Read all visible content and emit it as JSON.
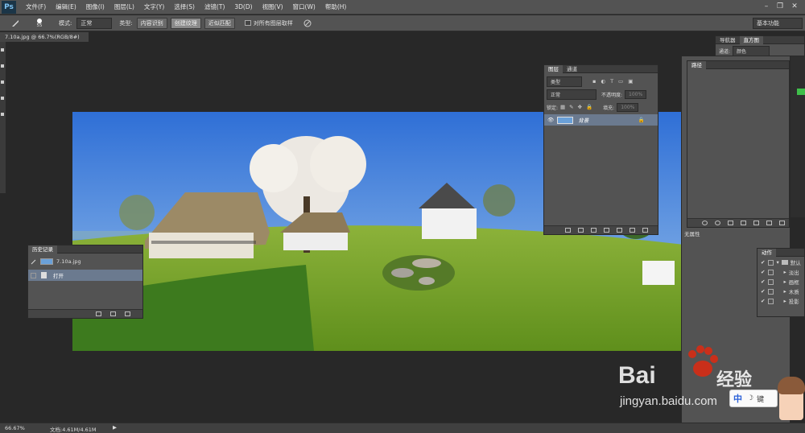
{
  "app": {
    "logo": "Ps",
    "workspace": "基本功能"
  },
  "menu": [
    "文件(F)",
    "编辑(E)",
    "图像(I)",
    "图层(L)",
    "文字(Y)",
    "选择(S)",
    "滤镜(T)",
    "3D(D)",
    "视图(V)",
    "窗口(W)",
    "帮助(H)"
  ],
  "window_controls": {
    "minimize": "–",
    "restore": "❐",
    "close": "✕"
  },
  "options": {
    "brush_size": "55",
    "mode_label": "模式:",
    "mode_value": "正常",
    "type_label": "类型:",
    "type_buttons": [
      "内容识别",
      "创建纹理",
      "近似匹配"
    ],
    "sample_all_label": "对所有图层取样"
  },
  "document": {
    "tab_title": "7.10a.jpg @ 66.7%(RGB/8#)"
  },
  "status": {
    "zoom": "66.67%",
    "doc_info": "文档:4.61M/4.61M"
  },
  "history_panel": {
    "tab": "历史记录",
    "snapshot_name": "7.10a.jpg",
    "step_name": "打开"
  },
  "layers_panel": {
    "tabs": [
      "图层",
      "通道"
    ],
    "filter_kind": "类型",
    "blend_mode": "正常",
    "opacity_label": "不透明度:",
    "opacity_value": "100%",
    "lock_label": "锁定:",
    "fill_label": "填充:",
    "fill_value": "100%",
    "layer_name": "背景"
  },
  "navigator_tabs": [
    "导航器",
    "直方图"
  ],
  "navigator_channel_label": "通道:",
  "navigator_channel_value": "颜色",
  "paths_panel": {
    "tab": "路径"
  },
  "properties_panel": {
    "tab": "无属性"
  },
  "actions_panel": {
    "tab": "动作",
    "items": [
      "默认",
      "淡出",
      "画框",
      "木质",
      "投影"
    ]
  },
  "watermark": {
    "brand": "Bai",
    "brand_cn": "经验",
    "url": "jingyan.baidu.com",
    "badge": "中",
    "badge_end": "键"
  },
  "colors": {
    "ui_dark": "#282828",
    "panel": "#535353",
    "accent": "#7fc3f2",
    "baidu_red": "#de2910",
    "baidu_blue": "#2a60d8"
  }
}
